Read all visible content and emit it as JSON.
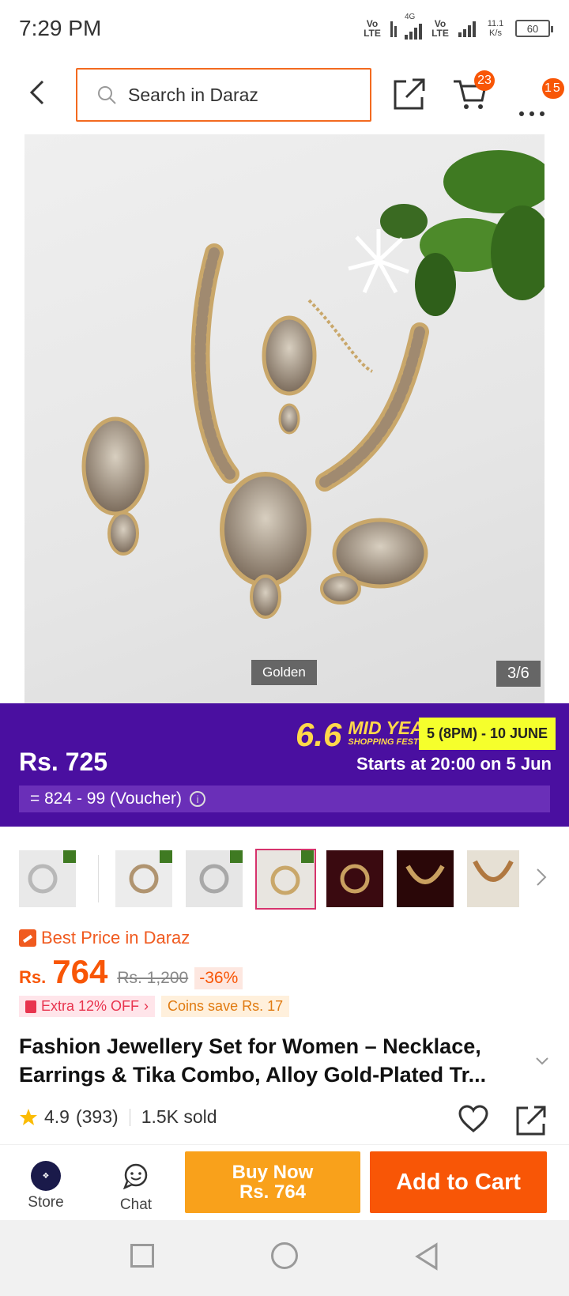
{
  "status_bar": {
    "time": "7:29 PM",
    "net1": "Vo LTE",
    "net2": "4G",
    "net3": "Vo LTE",
    "speed": "11.1 K/s",
    "battery": "60"
  },
  "header": {
    "search_placeholder": "Search in Daraz",
    "cart_count": "23",
    "more_count": "15"
  },
  "gallery": {
    "variant_label": "Golden",
    "counter": "3/6"
  },
  "promo": {
    "price": "Rs. 725",
    "event_number": "6.6",
    "event_line1": "MID YEAR",
    "event_line2": "SHOPPING FEST!",
    "event_date": "5 (8PM) - 10 JUNE",
    "starts_text": "Starts at 20:00 on 5 Jun",
    "voucher_text": "= 824 - 99 (Voucher)",
    "colors": {
      "background": "#4a0fa0",
      "voucher_bar": "#6a2fb8",
      "date_badge": "#f5ff2c"
    }
  },
  "thumbnails": {
    "count": 8,
    "selected_index": 3,
    "colors": [
      "#e9e9e9",
      "#ececec",
      "#e6e6e6",
      "#e8e5e0",
      "#3a0a10",
      "#2a0708",
      "#e6e0d4",
      "#f3f3f3"
    ]
  },
  "pricing": {
    "best_price_label": "Best Price in Daraz",
    "currency": "Rs.",
    "price": "764",
    "original_price": "Rs. 1,200",
    "discount": "-36%",
    "extra_off": "Extra 12% OFF",
    "coins_save": "Coins save Rs. 17",
    "accent": "#f85606"
  },
  "product": {
    "title": "Fashion Jewellery Set for Women – Necklace, Earrings & Tika Combo, Alloy Gold-Plated Tr...",
    "rating": "4.9",
    "reviews": "(393)",
    "sold": "1.5K sold"
  },
  "bottom_bar": {
    "store_label": "Store",
    "chat_label": "Chat",
    "buy_now_line1": "Buy Now",
    "buy_now_line2": "Rs. 764",
    "add_to_cart": "Add to Cart"
  }
}
